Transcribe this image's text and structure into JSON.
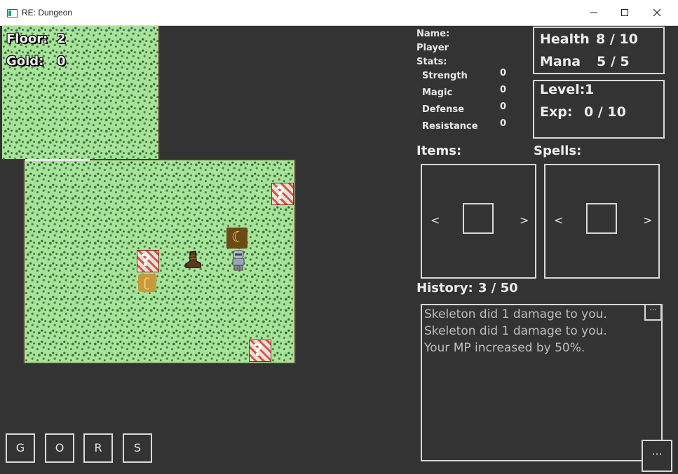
{
  "window": {
    "title": "RE: Dungeon"
  },
  "hud": {
    "floor_label": "Floor:",
    "floor_value": "2",
    "gold_label": "Gold:",
    "gold_value": "0"
  },
  "buttons": [
    "G",
    "O",
    "R",
    "S"
  ],
  "player": {
    "name_label": "Name:",
    "name": "Player",
    "stats_label": "Stats:",
    "stats": [
      {
        "label": "Strength",
        "value": "0"
      },
      {
        "label": "Magic",
        "value": "0"
      },
      {
        "label": "Defense",
        "value": "0"
      },
      {
        "label": "Resistance",
        "value": "0"
      }
    ]
  },
  "vitals": {
    "health_label": "Health",
    "health_value": "8 / 10",
    "mana_label": "Mana",
    "mana_value": "5 / 5"
  },
  "progress": {
    "level_label": "Level:",
    "level_value": "1",
    "exp_label": "Exp:",
    "exp_value": "0 / 10"
  },
  "items": {
    "label": "Items:",
    "prev": "<",
    "next": ">"
  },
  "spells": {
    "label": "Spells:",
    "prev": "<",
    "next": ">"
  },
  "history": {
    "label": "History:",
    "count": "3 / 50",
    "entries": [
      "Skeleton did 1 damage to you.",
      "Skeleton did 1 damage to you.",
      "Your MP increased by 50%."
    ],
    "more_small": "···",
    "more_large": "···"
  }
}
